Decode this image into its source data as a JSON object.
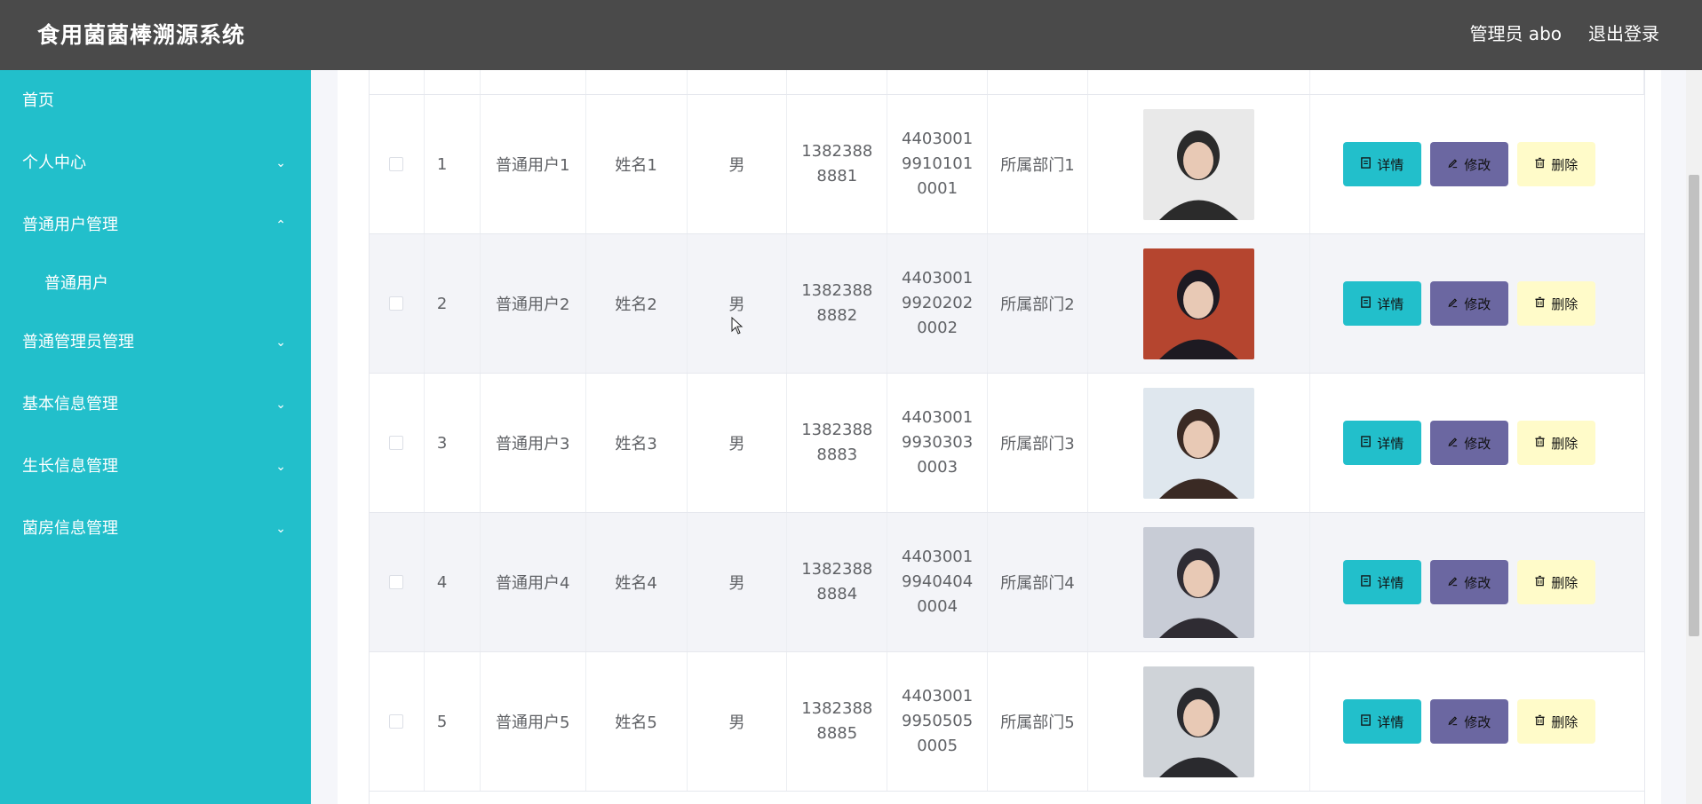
{
  "header": {
    "title": "食用菌菌棒溯源系统",
    "admin_label": "管理员 abo",
    "logout_label": "退出登录"
  },
  "sidebar": {
    "home": "首页",
    "personal_center": "个人中心",
    "normal_user_mgmt": "普通用户管理",
    "normal_user": "普通用户",
    "normal_admin_mgmt": "普通管理员管理",
    "basic_info_mgmt": "基本信息管理",
    "growth_info_mgmt": "生长信息管理",
    "room_info_mgmt": "菌房信息管理"
  },
  "buttons": {
    "detail": "详情",
    "edit": "修改",
    "delete": "删除"
  },
  "rows": [
    {
      "index": "1",
      "account": "普通用户1",
      "name": "姓名1",
      "gender": "男",
      "phone": "13823888881",
      "id_card": "440300199101010001",
      "department": "所属部门1",
      "avatar_colors": [
        "#e9e9e9",
        "#2b2b2b"
      ]
    },
    {
      "index": "2",
      "account": "普通用户2",
      "name": "姓名2",
      "gender": "男",
      "phone": "13823888882",
      "id_card": "440300199202020002",
      "department": "所属部门2",
      "avatar_colors": [
        "#b5452f",
        "#1d1a22"
      ]
    },
    {
      "index": "3",
      "account": "普通用户3",
      "name": "姓名3",
      "gender": "男",
      "phone": "13823888883",
      "id_card": "440300199303030003",
      "department": "所属部门3",
      "avatar_colors": [
        "#dfe7ee",
        "#3a2a24"
      ]
    },
    {
      "index": "4",
      "account": "普通用户4",
      "name": "姓名4",
      "gender": "男",
      "phone": "13823888884",
      "id_card": "440300199404040004",
      "department": "所属部门4",
      "avatar_colors": [
        "#c8ccd6",
        "#2f2c33"
      ]
    },
    {
      "index": "5",
      "account": "普通用户5",
      "name": "姓名5",
      "gender": "男",
      "phone": "13823888885",
      "id_card": "440300199505050005",
      "department": "所属部门5",
      "avatar_colors": [
        "#cfd3d8",
        "#2a2a2e"
      ]
    }
  ]
}
